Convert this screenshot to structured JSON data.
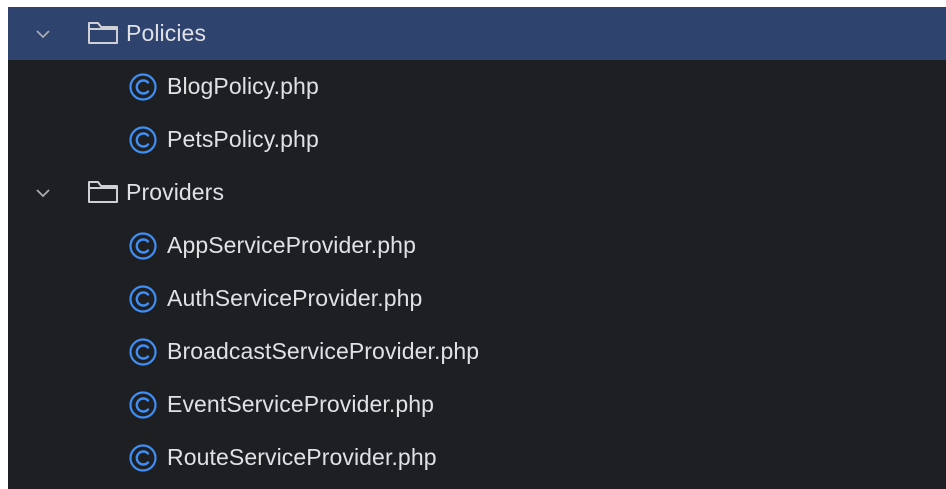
{
  "tree": {
    "policies_folder": {
      "label": "Policies",
      "files": [
        "BlogPolicy.php",
        "PetsPolicy.php"
      ]
    },
    "providers_folder": {
      "label": "Providers",
      "files": [
        "AppServiceProvider.php",
        "AuthServiceProvider.php",
        "BroadcastServiceProvider.php",
        "EventServiceProvider.php",
        "RouteServiceProvider.php"
      ]
    }
  },
  "icons": {
    "expand": "chevron-down-icon",
    "folder": "folder-icon",
    "php_class": "class-icon"
  },
  "colors": {
    "background": "#1e1f22",
    "selection": "#2e436e",
    "text": "#dfe1e5",
    "class_icon": "#3f8ef5",
    "folder_icon": "#ced0d6"
  }
}
